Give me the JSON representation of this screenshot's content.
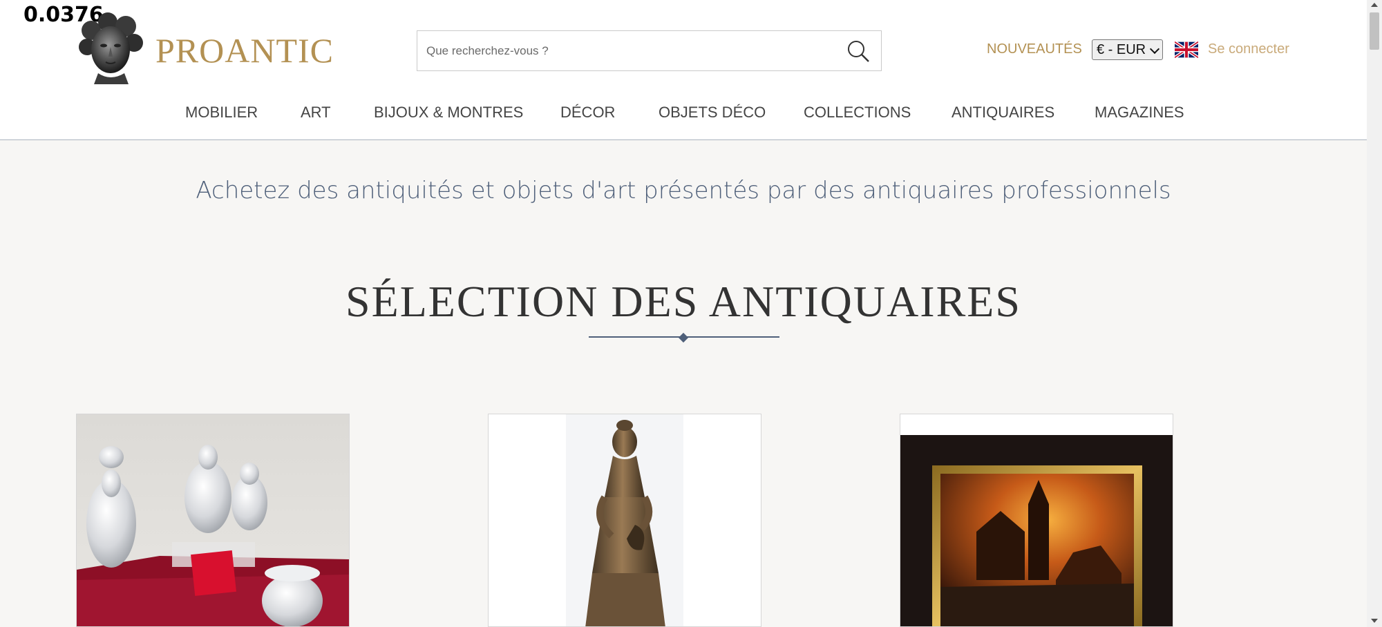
{
  "overlay": {
    "value": "0.0376"
  },
  "brand": {
    "name": "PROANTIC",
    "logo_icon": "classical-bust-logo",
    "color": "#b39153"
  },
  "search": {
    "placeholder": "Que recherchez-vous ?"
  },
  "header": {
    "new_label": "NOUVEAUTÉS",
    "currency": "€ - EUR",
    "language_flag_icon": "uk-flag-icon",
    "login_label": "Se connecter"
  },
  "nav": {
    "items": [
      {
        "label": "MOBILIER"
      },
      {
        "label": "ART"
      },
      {
        "label": "BIJOUX & MONTRES"
      },
      {
        "label": "DÉCOR"
      },
      {
        "label": "OBJETS DÉCO"
      },
      {
        "label": "COLLECTIONS"
      },
      {
        "label": "ANTIQUAIRES"
      },
      {
        "label": "MAGAZINES"
      }
    ]
  },
  "main": {
    "tagline": "Achetez des antiquités et objets d'art présentés par des antiquaires professionnels",
    "section_title": "SÉLECTION DES ANTIQUAIRES",
    "cards": [
      {
        "image": "crystal-perfume-bottles-photo"
      },
      {
        "image": "bronze-statue-photo"
      },
      {
        "image": "framed-fire-painting-photo"
      }
    ]
  },
  "colors": {
    "accent": "#b39153",
    "text_blue": "#4e5f79",
    "background": "#f7f6f4"
  }
}
